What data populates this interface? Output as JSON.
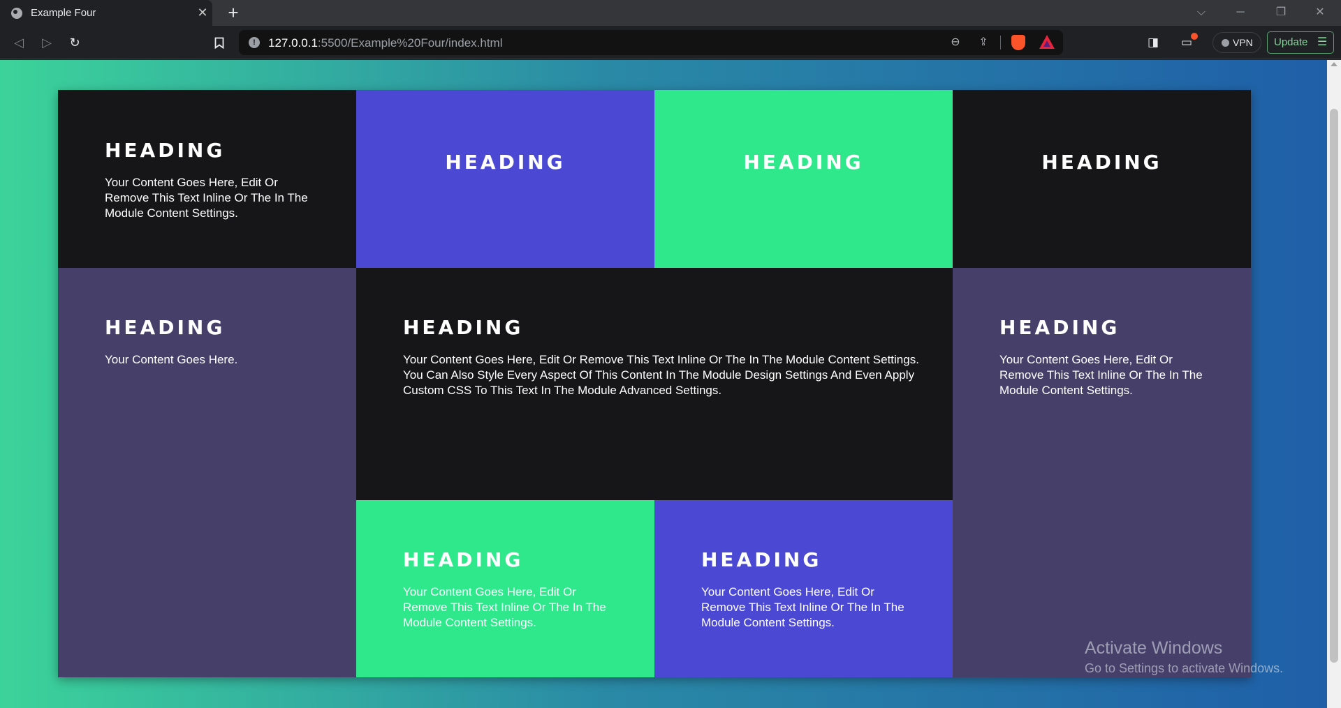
{
  "browser": {
    "tab": {
      "title": "Example Four",
      "close": "✕"
    },
    "new_tab": "+",
    "window_controls": {
      "list_tabs": "⌵",
      "minimize": "─",
      "restore": "❐",
      "close": "✕"
    },
    "nav": {
      "back": "◁",
      "forward": "▷",
      "reload": "↻"
    },
    "address": {
      "info_icon": "!",
      "host": "127.0.0.1",
      "path": ":5500/Example%20Four/index.html"
    },
    "url_actions": {
      "zoom": "⊖",
      "share": "⇪"
    },
    "toolbar": {
      "sidebar": "◨",
      "wallet": "▭",
      "vpn_label": "VPN",
      "update_label": "Update",
      "menu": "☰"
    }
  },
  "page": {
    "cells": [
      {
        "color": "dark",
        "heading": "HEADING",
        "text": "Your Content Goes Here, Edit Or Remove This Text Inline Or The In The Module Content Settings."
      },
      {
        "color": "blue",
        "heading": "HEADING"
      },
      {
        "color": "green",
        "heading": "HEADING"
      },
      {
        "color": "dark",
        "heading": "HEADING"
      },
      {
        "color": "purple",
        "heading": "HEADING",
        "text": "Your Content Goes Here."
      },
      {
        "color": "dark",
        "heading": "HEADING",
        "text": "Your Content Goes Here, Edit Or Remove This Text Inline Or The In The Module Content Settings. You Can Also Style Every Aspect Of This Content In The Module Design Settings And Even Apply Custom CSS To This Text In The Module Advanced Settings."
      },
      {
        "color": "purple",
        "heading": "HEADING",
        "text": "Your Content Goes Here, Edit Or Remove This Text Inline Or The In The Module Content Settings."
      },
      {
        "color": "green",
        "heading": "HEADING",
        "text": "Your Content Goes Here, Edit Or Remove This Text Inline Or The In The Module Content Settings."
      },
      {
        "color": "blue",
        "heading": "HEADING",
        "text": "Your Content Goes Here, Edit Or Remove This Text Inline Or The In The Module Content Settings."
      }
    ]
  },
  "watermark": {
    "title": "Activate Windows",
    "subtitle": "Go to Settings to activate Windows."
  },
  "colors": {
    "dark": "#161618",
    "blue": "#4b49d4",
    "green": "#2ee88b",
    "purple": "#463f6a",
    "update_accent": "#58a16f",
    "brave_orange": "#fb542b"
  }
}
